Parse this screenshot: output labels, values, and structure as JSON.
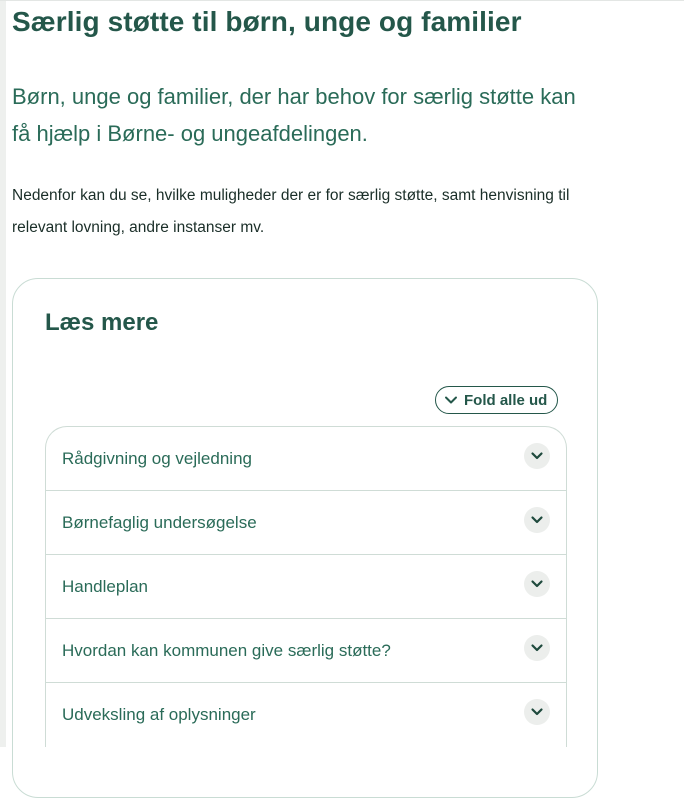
{
  "page": {
    "title": "Særlig støtte til børn, unge og familier",
    "lead": "Børn, unge og familier, der har behov for særlig støtte kan få hjælp i Børne- og ungeafdelingen.",
    "intro": "Nedenfor kan du se, hvilke muligheder der er for særlig støtte, samt henvisning til relevant lovning, andre instanser mv."
  },
  "card": {
    "title": "Læs mere",
    "fold_all_label": "Fold alle ud",
    "items": [
      {
        "label": "Rådgivning og vejledning",
        "icon": "chevron-down-icon"
      },
      {
        "label": "Børnefaglig undersøgelse",
        "icon": "chevron-down-icon"
      },
      {
        "label": "Handleplan",
        "icon": "chevron-down-icon"
      },
      {
        "label": "Hvordan kan kommunen give særlig støtte?",
        "icon": "chevron-down-icon"
      },
      {
        "label": "Udveksling af oplysninger",
        "icon": "chevron-down-icon"
      }
    ]
  },
  "colors": {
    "heading": "#24574a",
    "accent_text": "#2a6b58",
    "body_text": "#1a2e28",
    "border": "#cfdcd6",
    "toggle_bg": "#eceeec"
  }
}
